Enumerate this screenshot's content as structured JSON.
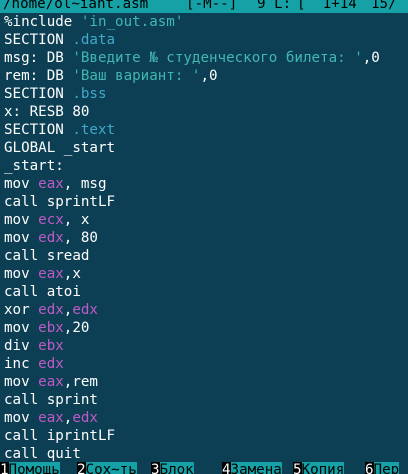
{
  "status_bar": {
    "path": "/home/ol~iant.asm",
    "mode": "[-M--]",
    "column": "9 L:",
    "position": "[  1+14",
    "total": "15/"
  },
  "editor": {
    "lines": [
      [
        {
          "t": "%include ",
          "c": "dir"
        },
        {
          "t": "'in_out.asm'",
          "c": "str"
        }
      ],
      [
        {
          "t": "SECTION ",
          "c": "dir"
        },
        {
          "t": ".data",
          "c": "sec"
        }
      ],
      [
        {
          "t": "msg: DB ",
          "c": "dir"
        },
        {
          "t": "'Введите № студенческого билета: '",
          "c": "str"
        },
        {
          "t": ",0",
          "c": "dir"
        }
      ],
      [
        {
          "t": "rem: DB ",
          "c": "dir"
        },
        {
          "t": "'Ваш вариант: '",
          "c": "str"
        },
        {
          "t": ",0",
          "c": "dir"
        }
      ],
      [
        {
          "t": "SECTION ",
          "c": "dir"
        },
        {
          "t": ".bss",
          "c": "sec"
        }
      ],
      [
        {
          "t": "x: RESB 80",
          "c": "dir"
        }
      ],
      [
        {
          "t": "SECTION ",
          "c": "dir"
        },
        {
          "t": ".text",
          "c": "sec"
        }
      ],
      [
        {
          "t": "GLOBAL _start",
          "c": "dir"
        }
      ],
      [
        {
          "t": "_start:",
          "c": "dir"
        }
      ],
      [
        {
          "t": "mov ",
          "c": "txt"
        },
        {
          "t": "eax",
          "c": "reg"
        },
        {
          "t": ", msg",
          "c": "txt"
        }
      ],
      [
        {
          "t": "call sprintLF",
          "c": "txt"
        }
      ],
      [
        {
          "t": "mov ",
          "c": "txt"
        },
        {
          "t": "ecx",
          "c": "reg"
        },
        {
          "t": ", x",
          "c": "txt"
        }
      ],
      [
        {
          "t": "mov ",
          "c": "txt"
        },
        {
          "t": "edx",
          "c": "reg"
        },
        {
          "t": ", 80",
          "c": "txt"
        }
      ],
      [
        {
          "t": "call sread",
          "c": "txt"
        }
      ],
      [
        {
          "t": "mov ",
          "c": "txt"
        },
        {
          "t": "eax",
          "c": "reg"
        },
        {
          "t": ",x",
          "c": "txt"
        }
      ],
      [
        {
          "t": "call atoi",
          "c": "txt"
        }
      ],
      [
        {
          "t": "xor ",
          "c": "txt"
        },
        {
          "t": "edx",
          "c": "reg"
        },
        {
          "t": ",",
          "c": "txt"
        },
        {
          "t": "edx",
          "c": "reg"
        }
      ],
      [
        {
          "t": "mov ",
          "c": "txt"
        },
        {
          "t": "ebx",
          "c": "reg"
        },
        {
          "t": ",20",
          "c": "txt"
        }
      ],
      [
        {
          "t": "div ",
          "c": "txt"
        },
        {
          "t": "ebx",
          "c": "reg"
        }
      ],
      [
        {
          "t": "inc ",
          "c": "txt"
        },
        {
          "t": "edx",
          "c": "reg"
        }
      ],
      [
        {
          "t": "mov ",
          "c": "txt"
        },
        {
          "t": "eax",
          "c": "reg"
        },
        {
          "t": ",rem",
          "c": "txt"
        }
      ],
      [
        {
          "t": "call sprint",
          "c": "txt"
        }
      ],
      [
        {
          "t": "mov ",
          "c": "txt"
        },
        {
          "t": "eax",
          "c": "reg"
        },
        {
          "t": ",",
          "c": "txt"
        },
        {
          "t": "edx",
          "c": "reg"
        }
      ],
      [
        {
          "t": "call iprintLF",
          "c": "txt"
        }
      ],
      [
        {
          "t": "call quit",
          "c": "txt"
        }
      ]
    ]
  },
  "function_keys": [
    {
      "num": "1",
      "label": "Помощь"
    },
    {
      "num": "2",
      "label": "Сох~ть"
    },
    {
      "num": "3",
      "label": "Блок"
    },
    {
      "num": "4",
      "label": "Замена"
    },
    {
      "num": "5",
      "label": "Копия"
    },
    {
      "num": "6",
      "label": "Пер"
    }
  ]
}
